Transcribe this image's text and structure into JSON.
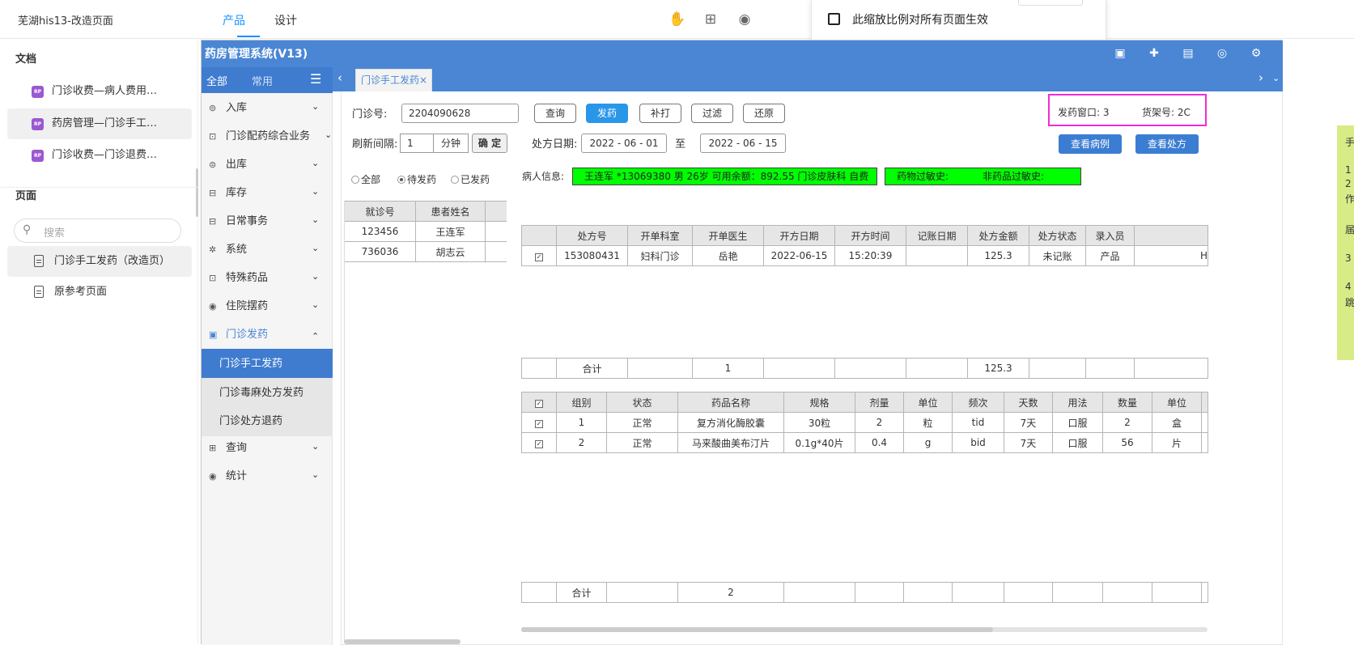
{
  "topbar": {
    "doc_title": "芜湖his13-改造页面",
    "tabs": [
      "产品",
      "设计"
    ],
    "popover_checkbox_label": "此缩放比例对所有页面生效"
  },
  "left_panel": {
    "docs_heading": "文档",
    "docs": [
      "门诊收费—病人费用…",
      "药房管理—门诊手工…",
      "门诊收费—门诊退费…"
    ],
    "rp_badge": "RP",
    "pages_heading": "页面",
    "search_placeholder": "搜索",
    "pages": [
      "门诊手工发药（改造页）",
      "原参考页面"
    ]
  },
  "app": {
    "title": "药房管理系统(V13)",
    "nav_tabs": [
      "全部",
      "常用"
    ],
    "nav_items": [
      {
        "label": "入库",
        "icon": "⊜"
      },
      {
        "label": "门诊配药综合业务",
        "icon": "⊡"
      },
      {
        "label": "出库",
        "icon": "⊜"
      },
      {
        "label": "库存",
        "icon": "⊟"
      },
      {
        "label": "日常事务",
        "icon": "⊟"
      },
      {
        "label": "系统",
        "icon": "✲"
      },
      {
        "label": "特殊药品",
        "icon": "⊡"
      },
      {
        "label": "住院摆药",
        "icon": "◉"
      },
      {
        "label": "门诊发药",
        "icon": "▣"
      }
    ],
    "nav_sub_items": [
      "门诊手工发药",
      "门诊毒麻处方发药",
      "门诊处方退药"
    ],
    "nav_items_after": [
      {
        "label": "查询",
        "icon": "⊞"
      },
      {
        "label": "统计",
        "icon": "◉"
      }
    ],
    "page_tab": "门诊手工发药"
  },
  "form": {
    "clinic_no_label": "门诊号:",
    "clinic_no_value": "2204090628",
    "buttons": [
      "查询",
      "发药",
      "补打",
      "过滤",
      "还原"
    ],
    "refresh_label": "刷新间隔:",
    "refresh_value": "1",
    "refresh_unit": "分钟",
    "confirm_label": "确 定",
    "rx_date_label": "处方日期:",
    "date_from": "2022 - 06 - 01",
    "date_to_label": "至",
    "date_to": "2022 - 06 - 15",
    "window_label": "发药窗口:",
    "window_value": "3",
    "shelf_label": "货架号:",
    "shelf_value": "2C",
    "view_record_button": "查看病例",
    "view_rx_button": "查看处方",
    "radios": [
      "全部",
      "待发药",
      "已发药"
    ],
    "radio_selected": "待发药",
    "patient_info_label": "病人信息:",
    "patient_info": "王连军 *13069380   男   26岁   可用余额：892.55  门诊皮肤科   自费",
    "allergy_drug": "药物过敏史:",
    "allergy_nondrug": "非药品过敏史:"
  },
  "patient_table": {
    "headers": [
      "就诊号",
      "患者姓名"
    ],
    "rows": [
      [
        "123456",
        "王连军"
      ],
      [
        "736036",
        "胡志云"
      ]
    ]
  },
  "rx_table": {
    "headers": [
      "",
      "处方号",
      "开单科室",
      "开单医生",
      "开方日期",
      "开方时间",
      "记账日期",
      "处方金额",
      "处方状态",
      "录入员",
      ""
    ],
    "rows": [
      [
        "✓",
        "153080431",
        "妇科门诊",
        "岳艳",
        "2022-06-15",
        "15:20:39",
        "",
        "125.3",
        "未记账",
        "产品",
        "H"
      ]
    ],
    "total": [
      "",
      "合计",
      "",
      "1",
      "",
      "",
      "",
      "125.3",
      "",
      "",
      ""
    ]
  },
  "drug_table": {
    "headers": [
      "✓",
      "组别",
      "状态",
      "药品名称",
      "规格",
      "剂量",
      "单位",
      "频次",
      "天数",
      "用法",
      "数量",
      "单位"
    ],
    "rows": [
      [
        "✓",
        "1",
        "正常",
        "复方消化酶胶囊",
        "30粒",
        "2",
        "粒",
        "tid",
        "7天",
        "口服",
        "2",
        "盒"
      ],
      [
        "✓",
        "2",
        "正常",
        "马来酸曲美布汀片",
        "0.1g*40片",
        "0.4",
        "g",
        "bid",
        "7天",
        "口服",
        "56",
        "片"
      ]
    ],
    "total": [
      "",
      "合计",
      "",
      "2",
      "",
      "",
      "",
      "",
      "",
      "",
      "",
      ""
    ]
  },
  "side_note": [
    "手",
    "1",
    "2",
    "作",
    "届",
    "3",
    "4",
    "跳"
  ]
}
